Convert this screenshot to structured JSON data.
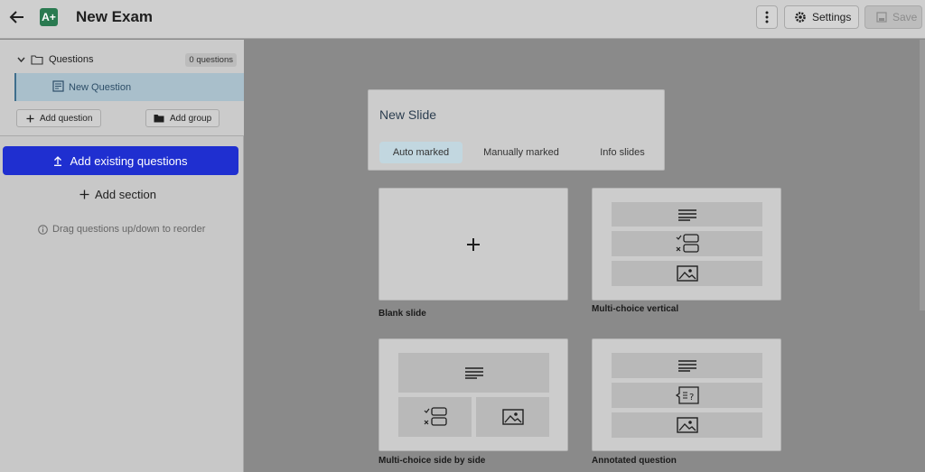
{
  "header": {
    "title": "New Exam",
    "logo_text": "A+",
    "settings_label": "Settings",
    "save_label": "Save"
  },
  "sidebar": {
    "group_label": "Questions",
    "question_count": "0 questions",
    "items": [
      {
        "label": "New Question"
      }
    ],
    "add_question_label": "Add question",
    "add_group_label": "Add group",
    "add_existing_label": "Add existing questions",
    "add_section_label": "Add section",
    "hint": "Drag questions up/down to reorder"
  },
  "new_slide": {
    "title": "New Slide",
    "tabs": [
      {
        "label": "Auto marked",
        "active": true
      },
      {
        "label": "Manually marked",
        "active": false
      },
      {
        "label": "Info slides",
        "active": false
      }
    ]
  },
  "templates": [
    {
      "label": "Blank slide"
    },
    {
      "label": "Multi-choice vertical"
    },
    {
      "label": "Multi-choice side by side"
    },
    {
      "label": "Annotated question"
    }
  ],
  "colors": {
    "primary_button": "#1f2fd0",
    "logo": "#2a7a50",
    "active_tab": "#c2d7e0",
    "selected_row": "#a9bfcb"
  },
  "icons": [
    "arrow-left-icon",
    "kebab-icon",
    "gear-icon",
    "save-icon",
    "chevron-down-icon",
    "folder-icon",
    "document-icon",
    "plus-icon",
    "folder-filled-icon",
    "upload-icon",
    "info-icon",
    "lines-icon",
    "checklist-icon",
    "image-icon",
    "question-bubble-icon"
  ]
}
